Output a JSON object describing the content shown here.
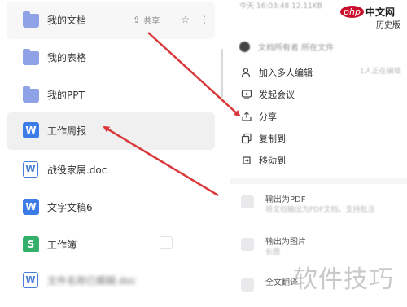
{
  "files": [
    {
      "name": "我的文档",
      "icon": "folder-icon"
    },
    {
      "name": "我的表格",
      "icon": "folder-icon"
    },
    {
      "name": "我的PPT",
      "icon": "folder-icon"
    },
    {
      "name": "工作周报",
      "icon": "word-icon"
    },
    {
      "name": "战役家属.doc",
      "icon": "word-outline-icon"
    },
    {
      "name": "文字文稿6",
      "icon": "word-icon"
    },
    {
      "name": "工作簿",
      "icon": "sheet-icon"
    },
    {
      "name": "文件名称已模糊.doc",
      "icon": "word-outline-icon"
    }
  ],
  "row_actions": {
    "share_label": "共享",
    "star_icon": "star-icon",
    "more_icon": "more-icon"
  },
  "detail": {
    "time_text": "今天 16:03:48    12.11KB",
    "history_link": "历史版",
    "user_text": "文档所有者    所在文件"
  },
  "menu": [
    {
      "label": "加入多人编辑",
      "icon": "multi-user-icon",
      "extra": "1人正在编辑"
    },
    {
      "label": "发起会议",
      "icon": "meeting-icon"
    },
    {
      "label": "分享",
      "icon": "share-icon"
    },
    {
      "label": "复制到",
      "icon": "copy-icon"
    },
    {
      "label": "移动到",
      "icon": "move-icon"
    }
  ],
  "export": [
    {
      "title": "输出为PDF",
      "sub": "将文档输出为PDF文档，支持批注"
    },
    {
      "title": "输出为图片",
      "sub": "长图"
    },
    {
      "title": "全文翻译",
      "sub": ""
    }
  ],
  "watermark": "软件技巧",
  "logo": {
    "php": "php",
    "cn": "中文网"
  },
  "colors": {
    "arrow": "#d9383a",
    "active_row": "#f0f0f1",
    "word_blue": "#3d7be6",
    "sheet_green": "#35b06a"
  }
}
